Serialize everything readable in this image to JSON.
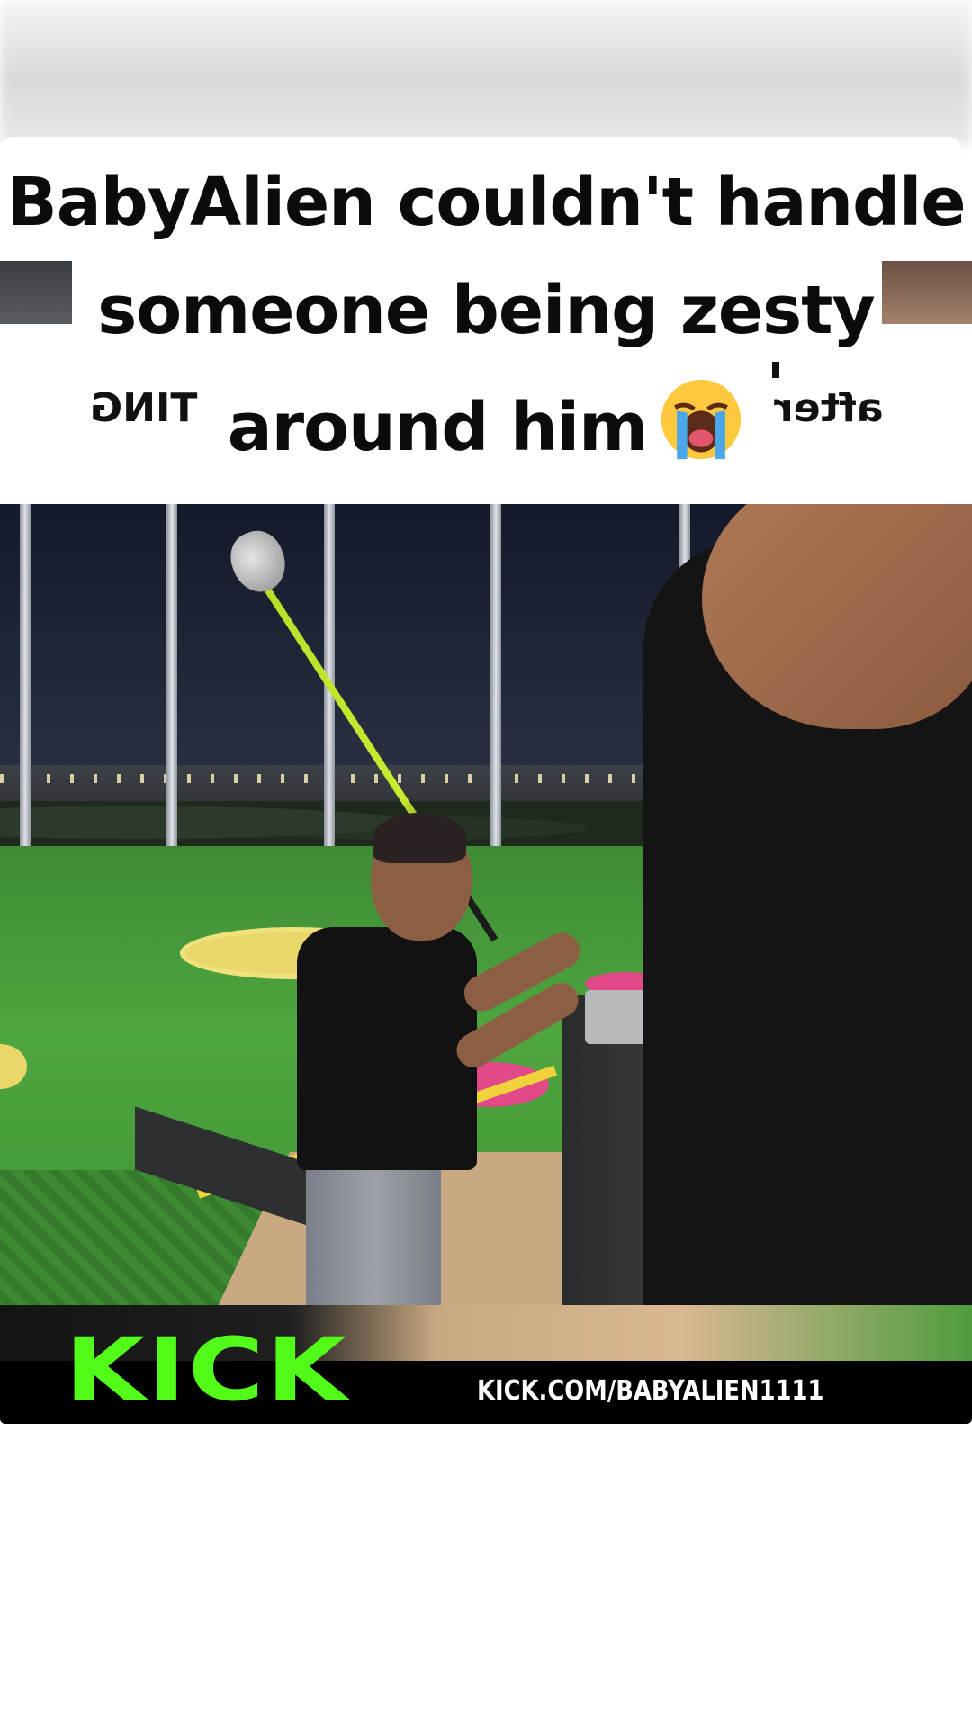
{
  "caption": {
    "line1": "BabyAlien couldn't handle",
    "line2": "someone being zesty",
    "line3": "around him",
    "emoji": "loudly-crying-face"
  },
  "background_text": {
    "mirrored_left": "TING",
    "mirrored_right": "after"
  },
  "banner": {
    "logo_text": "KICK",
    "url": "KICK.COM/BABYALIEN1111",
    "logo_color": "#53fc18"
  }
}
